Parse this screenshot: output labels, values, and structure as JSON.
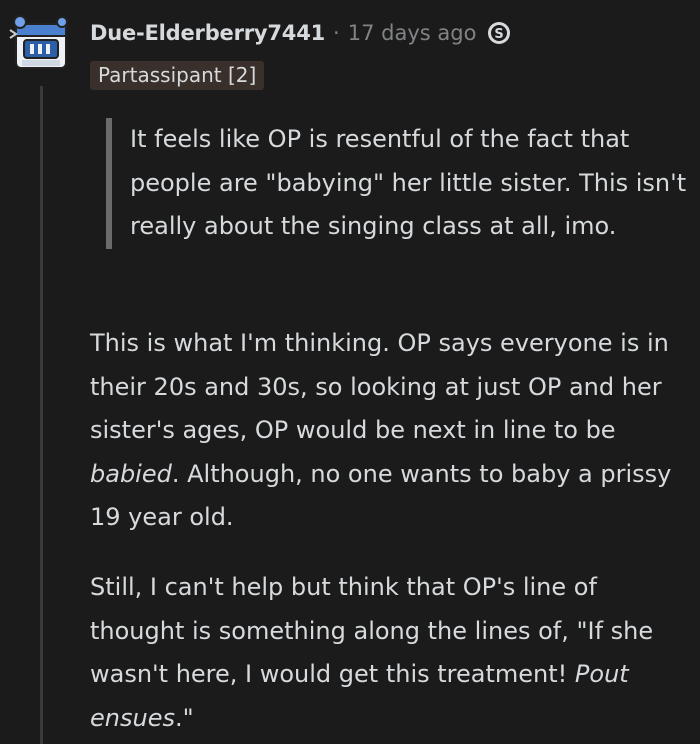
{
  "comment": {
    "username": "Due-Elderberry7441",
    "separator": "·",
    "time": "17 days ago",
    "flair": "Partassipant [2]",
    "award_icon": "snoo-coin-icon",
    "quote": "It feels like OP is resentful of the fact that people are \"babying\" her little sister. This isn't really about the singing class at all, imo.",
    "para1": {
      "before": "This is what I'm thinking. OP says everyone is in their 20s and 30s, so looking at just OP and her sister's ages, OP would be next in line to be ",
      "em": "babied",
      "after": ". Although, no one wants to baby a prissy 19 year old."
    },
    "para2": {
      "before": "Still, I can't help but think that OP's line of thought is something along the lines of, \"If she wasn't here, I would get this treatment! ",
      "em": "Pout ensues",
      "after": ".\""
    }
  },
  "colors": {
    "background": "#1b1b1c",
    "text": "#d7dadc",
    "muted": "#818384",
    "flair_bg": "#3a302b",
    "quote_bar": "#6b6b6b"
  }
}
